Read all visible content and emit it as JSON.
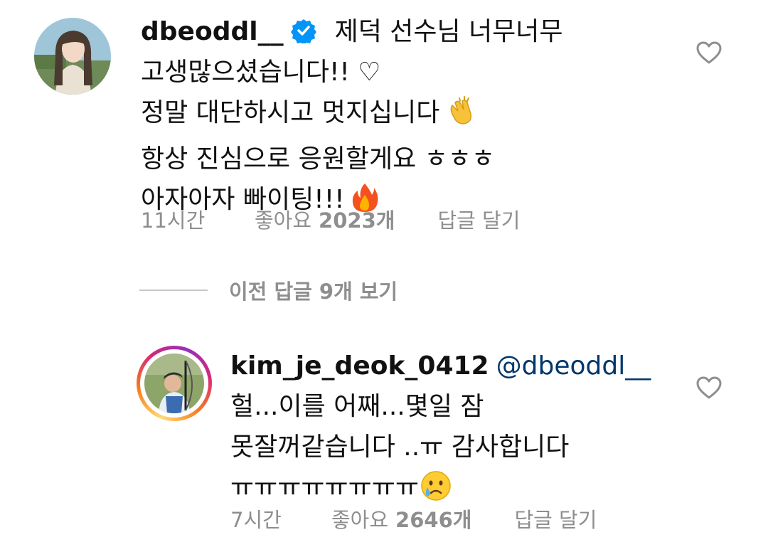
{
  "comments": [
    {
      "username": "dbeoddl__",
      "verified": true,
      "lines": [
        "제덕 선수님 너무너무",
        "고생많으셨습니다!! ♡",
        "정말 대단하시고 멋지십니다",
        "항상 진심으로 응원할게요 ㅎㅎㅎ",
        "아자아자 빠이팅!!!"
      ],
      "emojis": [
        "clap-emoji",
        "fire-emoji"
      ],
      "time": "11시간",
      "likes_label": "좋아요",
      "likes_count": "2023개",
      "reply_label": "답글 달기"
    }
  ],
  "view_replies": {
    "label": "이전 답글 9개 보기"
  },
  "reply": {
    "username": "kim_je_deok_0412",
    "mention": "@dbeoddl__",
    "lines": [
      "헐...이를 어째...몇일 잠",
      "못잘꺼같습니다 ..ㅠ 감사합니다",
      "ㅠㅠㅠㅠㅠㅠㅠㅠ"
    ],
    "emojis": [
      "crying-face-emoji"
    ],
    "time": "7시간",
    "likes_label": "좋아요",
    "likes_count": "2646개",
    "reply_label": "답글 달기"
  },
  "colors": {
    "text": "#111111",
    "meta": "#8e8e8e",
    "mention": "#00376b",
    "verified": "#0095f6"
  }
}
